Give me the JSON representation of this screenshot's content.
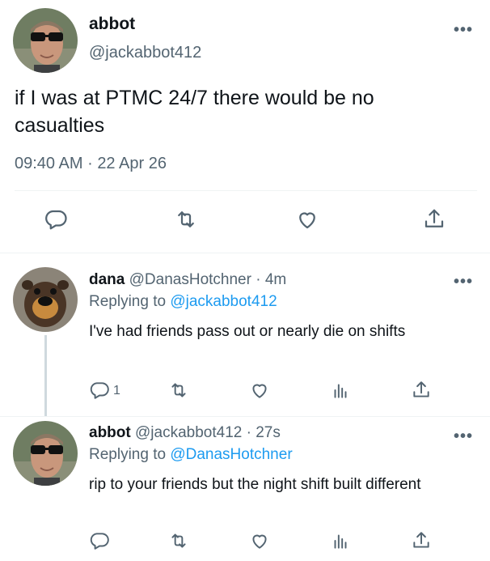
{
  "main_tweet": {
    "display_name": "abbot",
    "handle": "@jackabbot412",
    "text": "if I was at PTMC 24/7 there would be no casualties",
    "time": "09:40 AM",
    "date": "22 Apr 26",
    "meta_sep": "·",
    "more": "•••"
  },
  "replies": [
    {
      "display_name": "dana",
      "handle": "@DanasHotchner",
      "sep": "·",
      "age": "4m",
      "replying_prefix": "Replying to",
      "replying_to": "@jackabbot412",
      "text": "I've had friends pass out or nearly die on shifts",
      "reply_count": "1",
      "more": "•••"
    },
    {
      "display_name": "abbot",
      "handle": "@jackabbot412",
      "sep": "·",
      "age": "27s",
      "replying_prefix": "Replying to",
      "replying_to": "@DanasHotchner",
      "text": "rip to your friends but the night shift built different",
      "more": "•••"
    }
  ],
  "icons": {
    "reply": "reply-icon",
    "retweet": "retweet-icon",
    "like": "heart-icon",
    "share": "share-icon",
    "analytics": "analytics-icon"
  },
  "colors": {
    "text": "#0f1419",
    "secondary": "#536471",
    "link": "#1d9bf0",
    "divider": "#eff3f4"
  }
}
